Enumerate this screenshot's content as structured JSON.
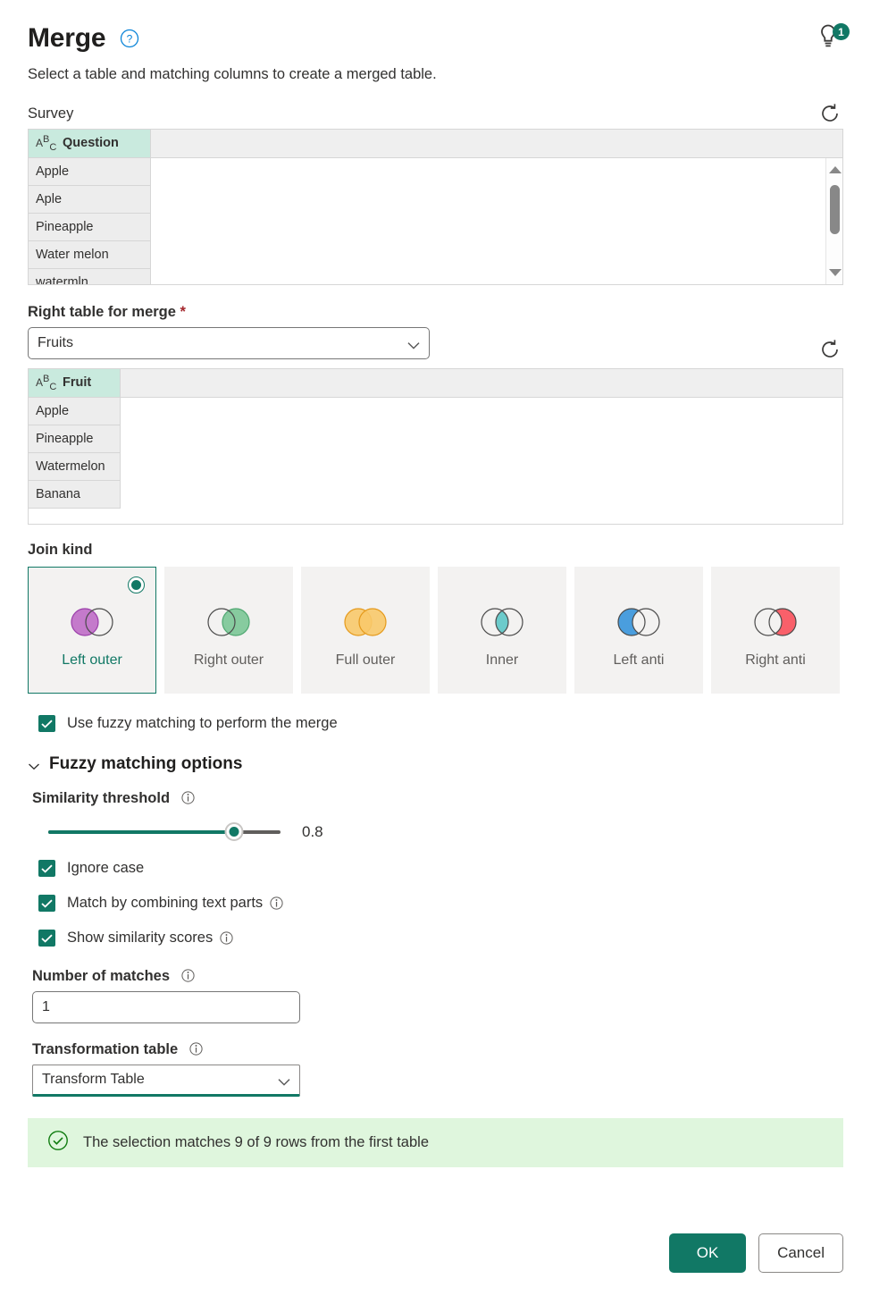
{
  "header": {
    "title": "Merge",
    "help_icon": "question-circle-icon",
    "subtitle": "Select a table and matching columns to create a merged table.",
    "tips_icon": "lightbulb-icon",
    "tips_badge": "1"
  },
  "left_table": {
    "label": "Survey",
    "refresh_icon": "refresh-icon",
    "column_header": "Question",
    "type_icon": "abc-text-type-icon",
    "rows": [
      "Apple",
      "Aple",
      "Pineapple",
      "Water melon",
      "watermln"
    ]
  },
  "right_table": {
    "label": "Right table for merge",
    "required_marker": "*",
    "selected_value": "Fruits",
    "chevron_icon": "chevron-down-icon",
    "refresh_icon": "refresh-icon",
    "column_header": "Fruit",
    "type_icon": "abc-text-type-icon",
    "rows": [
      "Apple",
      "Pineapple",
      "Watermelon",
      "Banana"
    ]
  },
  "join_kind": {
    "label": "Join kind",
    "selected": "Left outer",
    "options": [
      {
        "label": "Left outer",
        "venn": "left-filled",
        "color": "#b24bbd",
        "selected": true
      },
      {
        "label": "Right outer",
        "venn": "right-filled",
        "color": "#6cc08b",
        "selected": false
      },
      {
        "label": "Full outer",
        "venn": "both-filled",
        "color": "#f5b63f",
        "selected": false
      },
      {
        "label": "Inner",
        "venn": "intersection-filled",
        "color": "#54c4c4",
        "selected": false
      },
      {
        "label": "Left anti",
        "venn": "left-only-filled",
        "color": "#4a9ede",
        "selected": false
      },
      {
        "label": "Right anti",
        "venn": "right-only-filled",
        "color": "#f9606a",
        "selected": false
      }
    ]
  },
  "fuzzy": {
    "use_fuzzy_label": "Use fuzzy matching to perform the merge",
    "use_fuzzy_checked": true,
    "options_heading": "Fuzzy matching options",
    "options_expanded": true,
    "similarity_label": "Similarity threshold",
    "similarity_value": "0.8",
    "similarity_fraction": 0.8,
    "ignore_case_label": "Ignore case",
    "ignore_case_checked": true,
    "combine_parts_label": "Match by combining text parts",
    "combine_parts_checked": true,
    "show_scores_label": "Show similarity scores",
    "show_scores_checked": true,
    "number_of_matches_label": "Number of matches",
    "number_of_matches_value": "1",
    "transformation_table_label": "Transformation table",
    "transformation_table_value": "Transform Table"
  },
  "status": {
    "icon": "check-circle-icon",
    "message": "The selection matches 9 of 9 rows from the first table"
  },
  "footer": {
    "ok_label": "OK",
    "cancel_label": "Cancel"
  },
  "colors": {
    "accent_teal": "#117865",
    "selected_header": "#c9eade",
    "success_bg": "#dff6dd",
    "required_red": "#a4262c"
  }
}
